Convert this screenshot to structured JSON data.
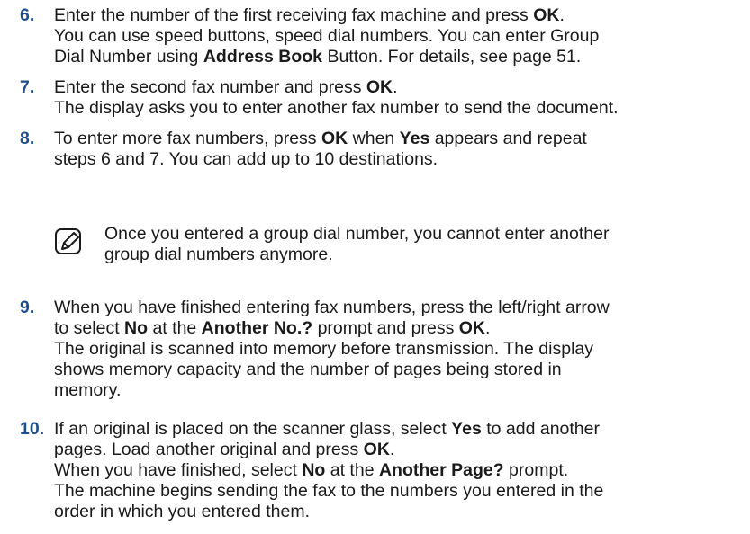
{
  "steps": [
    {
      "number": "6.",
      "lines": [
        [
          {
            "t": "Enter the number of the first receiving fax machine and press "
          },
          {
            "t": "OK",
            "b": true
          },
          {
            "t": "."
          }
        ],
        [
          {
            "t": "You can use speed buttons, speed dial numbers. You can enter Group"
          }
        ],
        [
          {
            "t": "Dial Number using "
          },
          {
            "t": "Address Book",
            "b": true
          },
          {
            "t": " Button. For details, see page 51."
          }
        ]
      ]
    },
    {
      "number": "7.",
      "lines": [
        [
          {
            "t": "Enter the second fax number and press "
          },
          {
            "t": "OK",
            "b": true
          },
          {
            "t": "."
          }
        ],
        [
          {
            "t": "The display asks you to enter another fax number to send the document."
          }
        ]
      ]
    },
    {
      "number": "8.",
      "lines": [
        [
          {
            "t": "To enter more fax numbers, press "
          },
          {
            "t": "OK",
            "b": true
          },
          {
            "t": " when "
          },
          {
            "t": "Yes",
            "b": true
          },
          {
            "t": " appears and repeat"
          }
        ],
        [
          {
            "t": "steps 6 and 7. You can add up to 10 destinations."
          }
        ]
      ]
    },
    {
      "number": "9.",
      "lines": [
        [
          {
            "t": "When you have finished entering fax numbers, press the left/right arrow"
          }
        ],
        [
          {
            "t": "to select "
          },
          {
            "t": "No",
            "b": true
          },
          {
            "t": " at the "
          },
          {
            "t": "Another No.?",
            "b": true
          },
          {
            "t": " prompt and press "
          },
          {
            "t": "OK",
            "b": true
          },
          {
            "t": "."
          }
        ],
        [
          {
            "t": "The original is scanned into memory before transmission. The display"
          }
        ],
        [
          {
            "t": "shows memory capacity and the number of pages being stored in"
          }
        ],
        [
          {
            "t": "memory."
          }
        ]
      ]
    },
    {
      "number": "10.",
      "lines": [
        [
          {
            "t": "If an original is placed on the scanner glass, select "
          },
          {
            "t": "Yes",
            "b": true
          },
          {
            "t": " to add another"
          }
        ],
        [
          {
            "t": "pages. Load another original and press "
          },
          {
            "t": "OK",
            "b": true
          },
          {
            "t": "."
          }
        ],
        [
          {
            "t": "When you have finished, select "
          },
          {
            "t": "No",
            "b": true
          },
          {
            "t": " at the "
          },
          {
            "t": "Another Page?",
            "b": true
          },
          {
            "t": " prompt."
          }
        ],
        [
          {
            "t": "The machine begins sending the fax to the numbers you entered in the"
          }
        ],
        [
          {
            "t": "order in which you entered them."
          }
        ]
      ]
    }
  ],
  "note": {
    "icon": "note-pencil-icon",
    "lines": [
      "Once you entered a group dial number, you cannot enter another",
      "group dial numbers anymore."
    ]
  },
  "colors": {
    "step_number": "#1f4e8c",
    "text": "#1a1a1a"
  }
}
